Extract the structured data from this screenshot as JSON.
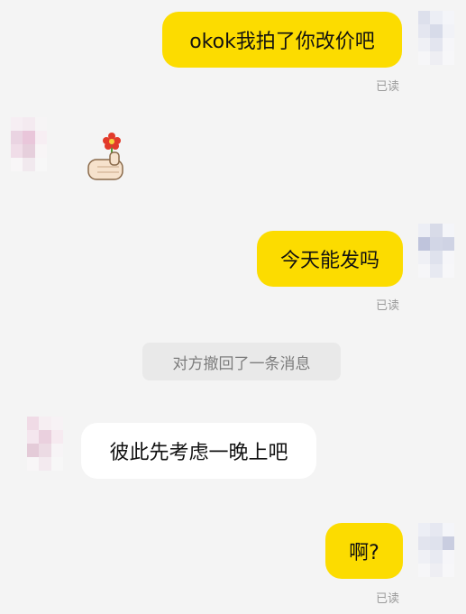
{
  "messages": [
    {
      "side": "right",
      "text": "okok我拍了你改价吧",
      "status": "已读"
    },
    {
      "side": "left",
      "sticker": "hand-holding-flower"
    },
    {
      "side": "right",
      "text": "今天能发吗",
      "status": "已读"
    },
    {
      "side": "system",
      "text": "对方撤回了一条消息"
    },
    {
      "side": "left",
      "text": "彼此先考虑一晚上吧"
    },
    {
      "side": "right",
      "text": "啊?",
      "status": "已读"
    }
  ],
  "colors": {
    "background": "#f4f4f4",
    "my_bubble": "#fcdc00",
    "their_bubble": "#ffffff",
    "system_bubble": "#e9e9e9",
    "status_text": "#9a9a9a"
  }
}
